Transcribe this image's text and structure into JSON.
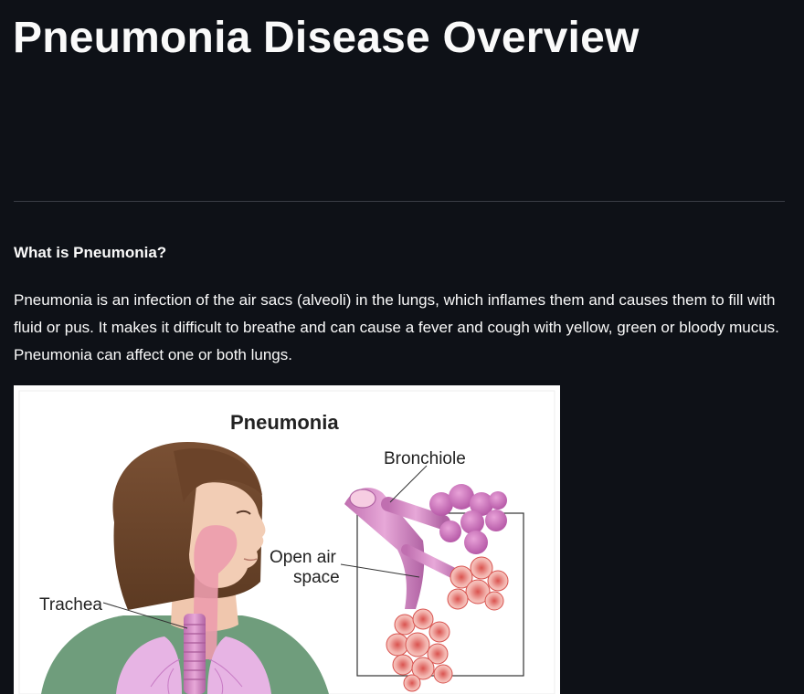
{
  "page": {
    "title": "Pneumonia Disease Overview",
    "section_heading": "What is Pneumonia?",
    "description": "Pneumonia is an infection of the air sacs (alveoli) in the lungs, which inflames them and causes them to fill with fluid or pus. It makes it difficult to breathe and can cause a fever and cough with yellow, green or bloody mucus. Pneumonia can affect one or both lungs."
  },
  "illustration": {
    "title": "Pneumonia",
    "labels": {
      "bronchiole": "Bronchiole",
      "open_air_line1": "Open air",
      "open_air_line2": "space",
      "trachea": "Trachea"
    }
  },
  "colors": {
    "background": "#0e1117",
    "text": "#fafafa",
    "divider": "#3a3d45"
  }
}
